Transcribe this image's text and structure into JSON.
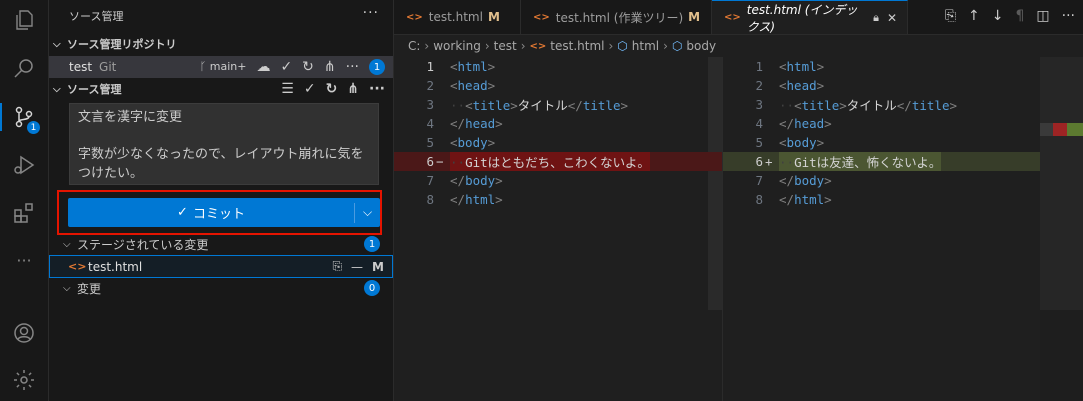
{
  "activity": {
    "scm_badge": "1"
  },
  "sidebar": {
    "title": "ソース管理",
    "more": "···",
    "repos_header": "ソース管理リポジトリ",
    "repo": {
      "name": "test",
      "type": "Git",
      "branch": "main+",
      "badge": "1"
    },
    "scm_header": "ソース管理",
    "commit_message_line1": "文言を漢字に変更",
    "commit_message_line2": "字数が少なくなったので、レイアウト崩れに気を",
    "commit_message_line3": "つけたい。",
    "commit_button": "コミット",
    "staged_label": "ステージされている変更",
    "staged_count": "1",
    "staged_file": {
      "name": "test.html",
      "status": "M"
    },
    "changes_label": "変更",
    "changes_count": "0"
  },
  "tabs": [
    {
      "label": "test.html",
      "status": "M"
    },
    {
      "label": "test.html (作業ツリー)",
      "status": "M"
    },
    {
      "label": "test.html (インデックス)"
    }
  ],
  "breadcrumb": {
    "drive": "C:",
    "folder1": "working",
    "folder2": "test",
    "file": "test.html",
    "el1": "html",
    "el2": "body"
  },
  "left_pane": {
    "lines": [
      {
        "n": "1",
        "tag": "html"
      },
      {
        "n": "2",
        "tag": "head"
      },
      {
        "n": "3",
        "inner": "タイトル",
        "tag": "title"
      },
      {
        "n": "4",
        "tag": "/head"
      },
      {
        "n": "5",
        "tag": "body"
      },
      {
        "n": "6",
        "marker": "−",
        "text": "Gitはともだち、こわくないよ。"
      },
      {
        "n": "7",
        "tag": "/body"
      },
      {
        "n": "8",
        "tag": "/html"
      }
    ]
  },
  "right_pane": {
    "lines": [
      {
        "n": "1",
        "tag": "html"
      },
      {
        "n": "2",
        "tag": "head"
      },
      {
        "n": "3",
        "inner": "タイトル",
        "tag": "title"
      },
      {
        "n": "4",
        "tag": "/head"
      },
      {
        "n": "5",
        "tag": "body"
      },
      {
        "n": "6",
        "marker": "+",
        "text": "Gitは友達、怖くないよ。"
      },
      {
        "n": "7",
        "tag": "/body"
      },
      {
        "n": "8",
        "tag": "/html"
      }
    ]
  },
  "colors": {
    "accent": "#0078d4",
    "highlight": "#e51400",
    "deleted": "#6f1313",
    "inserted": "#4b5632"
  }
}
